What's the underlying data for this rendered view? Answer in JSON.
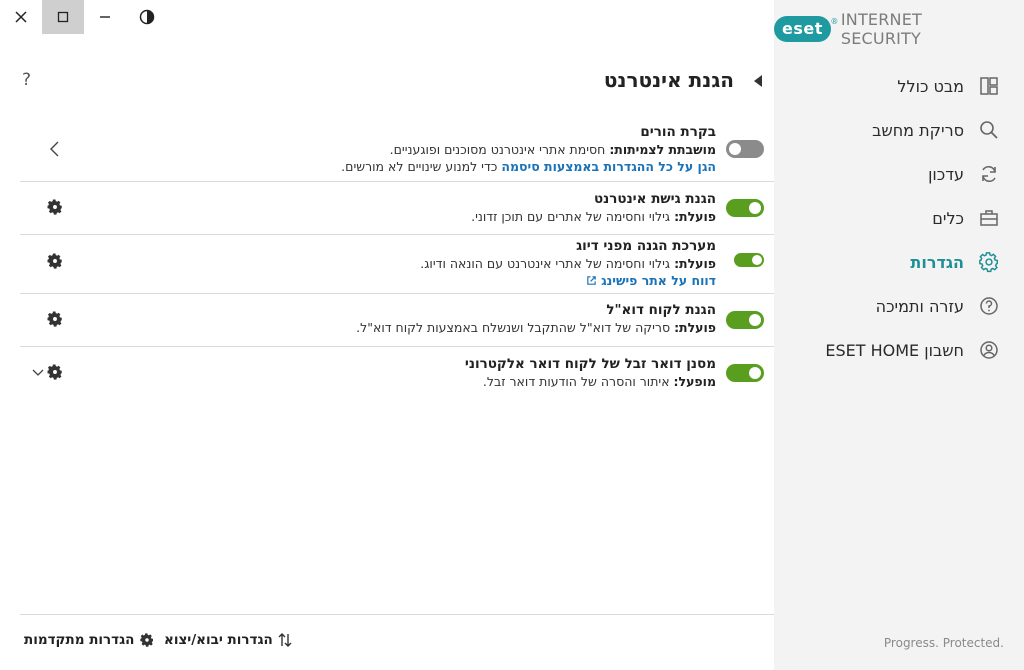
{
  "window": {
    "close_icon": "close-icon",
    "maximize_icon": "maximize-icon",
    "minimize_icon": "minimize-icon",
    "theme_icon": "contrast-icon"
  },
  "brand": {
    "logo_text": "eset",
    "registered": "®",
    "product": "INTERNET SECURITY",
    "accent": "#1f9aa0"
  },
  "sidebar": {
    "items": [
      {
        "label": "מבט כולל",
        "icon": "dashboard-icon"
      },
      {
        "label": "סריקת מחשב",
        "icon": "search-icon"
      },
      {
        "label": "עדכון",
        "icon": "refresh-icon"
      },
      {
        "label": "כלים",
        "icon": "briefcase-icon"
      },
      {
        "label": "הגדרות",
        "icon": "gear-icon",
        "active": true
      },
      {
        "label": "עזרה ותמיכה",
        "icon": "help-icon"
      },
      {
        "label": "חשבון ESET HOME",
        "icon": "account-icon"
      }
    ],
    "tagline": "Progress. Protected."
  },
  "main": {
    "title": "הגנת אינטרנט",
    "help_label": "?",
    "rows": [
      {
        "name": "בקרת הורים",
        "status_label": "מושבתת לצמיתות:",
        "status_desc": " חסימת אתרי אינטרנט מסוכנים ופוגעניים.",
        "link": "הגן על כל ההגדרות באמצעות סיסמה",
        "link_after": " כדי למנוע שינויים לא מורשים.",
        "enabled": false
      },
      {
        "name": "הגנת גישת אינטרנט",
        "status_label": "פועלת:",
        "status_desc": " גילוי וחסימה של אתרים עם תוכן זדוני.",
        "enabled": true
      },
      {
        "name": "מערכת הגנה מפני דיוג",
        "status_label": "פועלת:",
        "status_desc": " גילוי וחסימה של אתרי אינטרנט עם הונאה ודיוג.",
        "link": "דווח על אתר פישינג",
        "enabled": true
      },
      {
        "name": "הגנת לקוח דוא\"ל",
        "status_label": "פועלת:",
        "status_desc": " סריקה של דוא\"ל שהתקבל ושנשלח באמצעות לקוח דוא\"ל.",
        "enabled": true
      },
      {
        "name": "מסנן דואר זבל של לקוח דואר אלקטרוני",
        "status_label": "מופעל:",
        "status_desc": " איתור והסרה של הודעות דואר זבל.",
        "enabled": true
      }
    ]
  },
  "footer": {
    "import_export": "הגדרות יבוא/יצוא",
    "advanced": "הגדרות מתקדמות"
  },
  "colors": {
    "toggle_on": "#5a9e1f",
    "toggle_off": "#8b8b8b",
    "link": "#1a73b8",
    "sidebar_bg": "#f3f3f3"
  }
}
